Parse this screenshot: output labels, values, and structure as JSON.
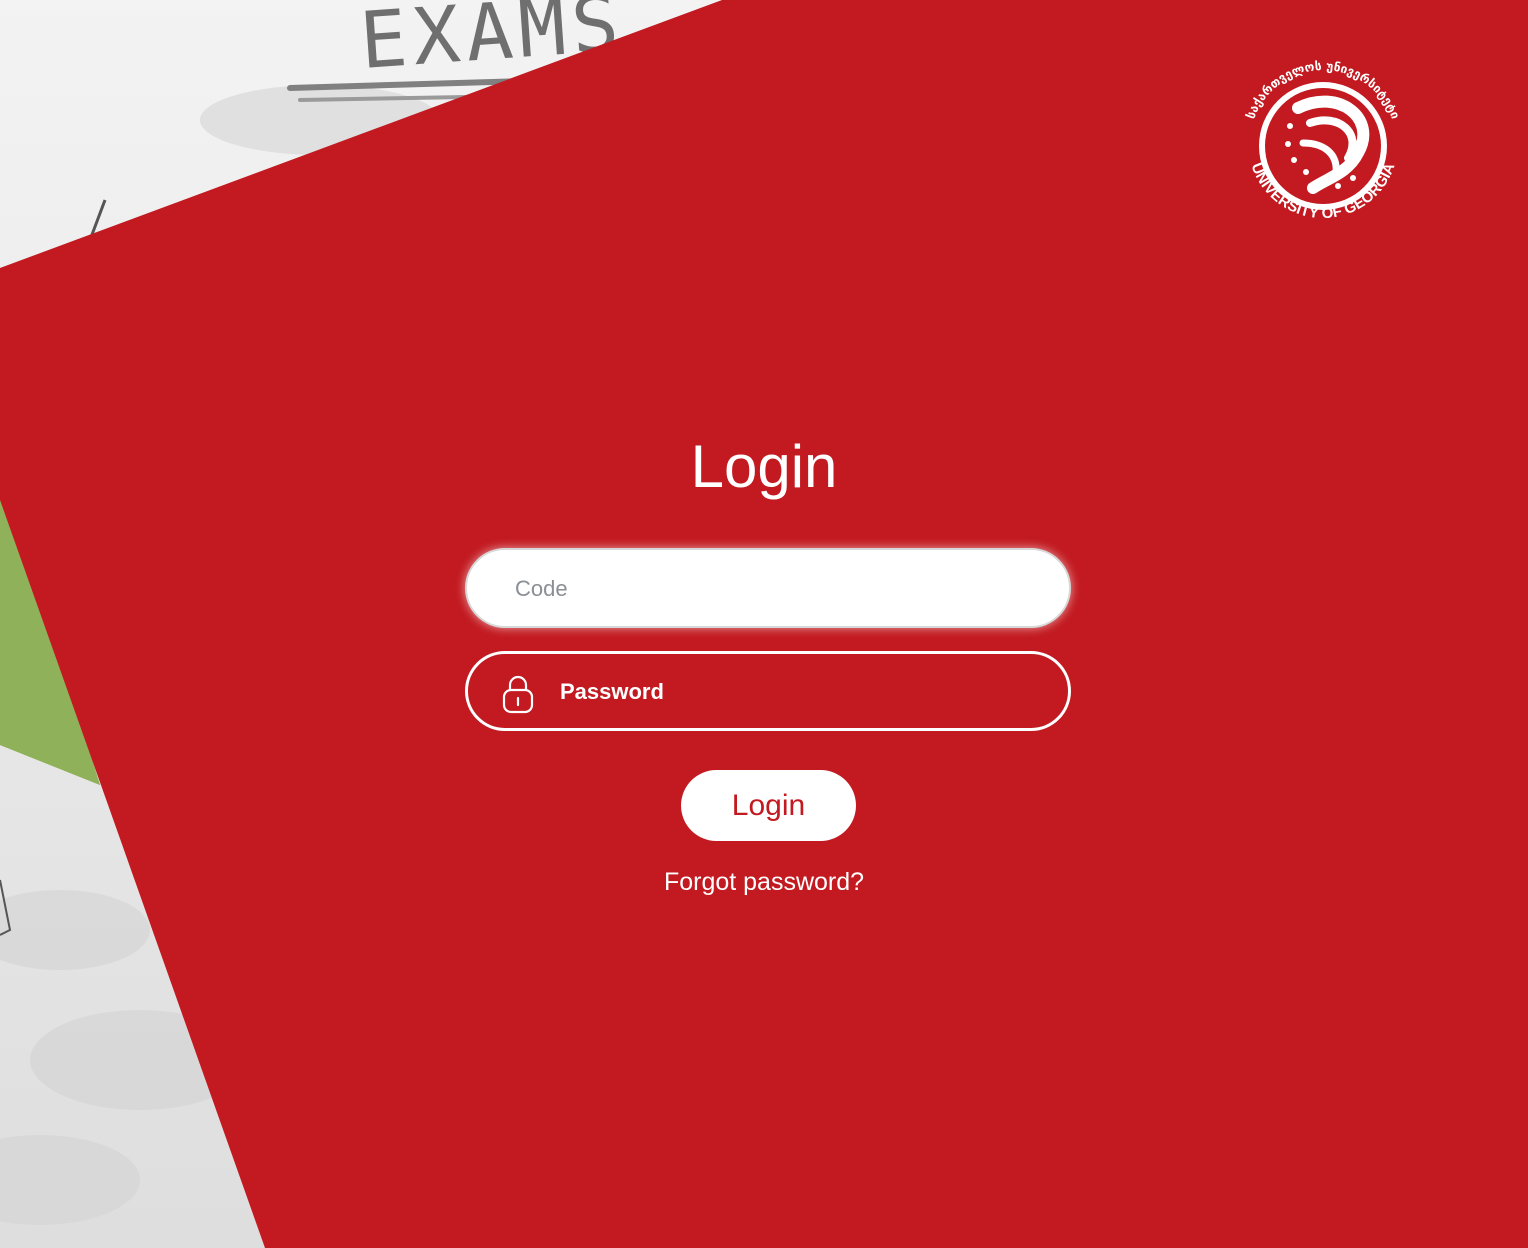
{
  "background": {
    "doodle_text": "EXAMS"
  },
  "brand": {
    "logo_text_en": "UNIVERSITY OF GEORGIA",
    "logo_text_ka": "საქართველოს უნივერსიტეტი",
    "primary_color": "#c21a20",
    "accent_green": "#8fb15a"
  },
  "login": {
    "title": "Login",
    "code_placeholder": "Code",
    "code_value": "",
    "password_placeholder": "Password",
    "password_icon": "lock-icon",
    "password_value": "",
    "submit_label": "Login",
    "forgot_link": "Forgot password?"
  }
}
